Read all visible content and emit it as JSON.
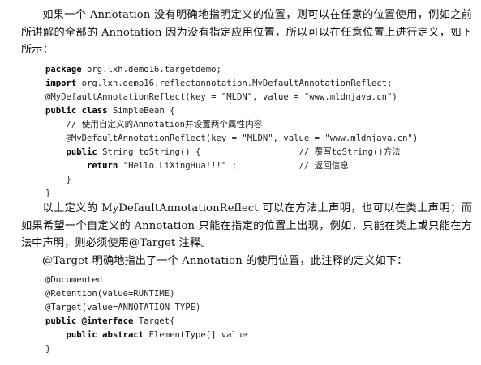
{
  "paragraph1": {
    "text": "如果一个 Annotation 没有明确地指明定义的位置，则可以在任意的位置使用，例如之前所讲解的全部的 Annotation 因为没有指定应用位置，所以可以在任意位置上进行定义，如下所示："
  },
  "code1": {
    "lines": [
      {
        "kw": "package",
        "rest": " org.lxh.demo16.targetdemo;"
      },
      {
        "kw": "import",
        "rest": " org.lxh.demo16.reflectannotation.MyDefaultAnnotationReflect;"
      },
      {
        "kw": "",
        "rest": "@MyDefaultAnnotationReflect(key = \"MLDN\", value = \"www.mldnjava.cn\")"
      },
      {
        "kw": "public class",
        "rest": " SimpleBean {"
      },
      {
        "kw": "",
        "rest": "    // 使用自定义的Annotation并设置两个属性内容"
      },
      {
        "kw": "",
        "rest": "    @MyDefaultAnnotationReflect(key = \"MLDN\", value = \"www.mldnjava.cn\")"
      },
      {
        "pre": "    ",
        "kw": "public",
        "rest": " String toString() {                   // 覆写toString()方法"
      },
      {
        "pre": "        ",
        "kw": "return",
        "rest": " \"Hello LiXingHua!!!\" ;            // 返回信息"
      },
      {
        "kw": "",
        "rest": "    }"
      },
      {
        "kw": "",
        "rest": "}"
      }
    ]
  },
  "paragraph2": {
    "text": "以上定义的 MyDefaultAnnotationReflect 可以在方法上声明，也可以在类上声明；而如果希望一个自定义的 Annotation 只能在指定的位置上出现，例如，只能在类上或只能在方法中声明，则必须使用@Target 注释。"
  },
  "paragraph3": {
    "text": "@Target 明确地指出了一个 Annotation 的使用位置，此注释的定义如下："
  },
  "code2": {
    "lines": [
      {
        "kw": "",
        "rest": "@Documented"
      },
      {
        "kw": "",
        "rest": "@Retention(value=RUNTIME)"
      },
      {
        "kw": "",
        "rest": "@Target(value=ANNOTATION_TYPE)"
      },
      {
        "kw": "public @interface",
        "rest": " Target{"
      },
      {
        "pre": "    ",
        "kw": "public abstract",
        "rest": " ElementType[] value"
      },
      {
        "kw": "",
        "rest": "}"
      }
    ]
  }
}
